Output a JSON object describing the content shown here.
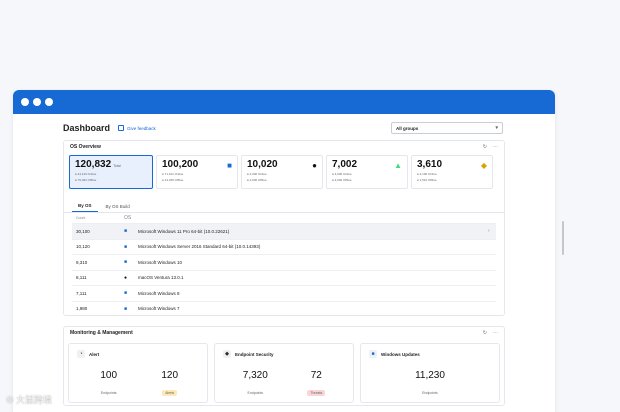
{
  "header": {
    "title": "Dashboard",
    "feedback_label": "Give feedback",
    "groups_value": "All groups"
  },
  "os_overview": {
    "title": "OS Overview",
    "stats": [
      {
        "value": "120,832",
        "sub": "Total",
        "line1": "● 44,123 Online",
        "line2": "● 76,462 Offline",
        "icon": ""
      },
      {
        "value": "100,200",
        "sub": "",
        "line1": "● 71,101 Online",
        "line2": "● 13,345 Offline",
        "icon": "windows-icon"
      },
      {
        "value": "10,020",
        "sub": "",
        "line1": "● 4,000 Online",
        "line2": "● 2,000 Offline",
        "icon": "apple-icon"
      },
      {
        "value": "7,002",
        "sub": "",
        "line1": "● 4,000 Online",
        "line2": "● 3,002 Offline",
        "icon": "android-icon"
      },
      {
        "value": "3,610",
        "sub": "",
        "line1": "● 2,100 Online",
        "line2": "● 1,510 Offline",
        "icon": "linux-icon"
      }
    ],
    "tabs": [
      "By OS",
      "By OS Build"
    ],
    "columns": {
      "count": "Count",
      "os": "OS"
    },
    "rows": [
      {
        "count": "30,100",
        "icon": "windows",
        "os": "Microsoft Windows 11 Pro 64-bit (10.0.22621)"
      },
      {
        "count": "10,120",
        "icon": "windows",
        "os": "Microsoft Windows Server 2016 Standard 64-bit (10.0.14393)"
      },
      {
        "count": "9,310",
        "icon": "windows",
        "os": "Microsoft Windows 10"
      },
      {
        "count": "8,111",
        "icon": "apple",
        "os": "macOS Ventura 13.0.1"
      },
      {
        "count": "7,111",
        "icon": "windows",
        "os": "Microsoft Windows 8"
      },
      {
        "count": "1,980",
        "icon": "windows",
        "os": "Microsoft Windows 7"
      }
    ]
  },
  "monitoring": {
    "title": "Monitoring & Management",
    "widgets": [
      {
        "title": "Alert",
        "values": [
          {
            "num": "100",
            "label": "Endpoints",
            "color": ""
          },
          {
            "num": "120",
            "label": "Alerts",
            "color": "#fde9b8"
          }
        ]
      },
      {
        "title": "Endpoint Security",
        "values": [
          {
            "num": "7,320",
            "label": "Endpoints",
            "color": ""
          },
          {
            "num": "72",
            "label": "Threats",
            "color": "#fbd4d8"
          }
        ]
      },
      {
        "title": "Windows Updates",
        "values": [
          {
            "num": "11,230",
            "label": "Endpoints",
            "color": ""
          }
        ]
      }
    ]
  },
  "colors": {
    "accent": "#1769d3",
    "windows": "#1769d3"
  },
  "watermark": "大鼠跨境"
}
